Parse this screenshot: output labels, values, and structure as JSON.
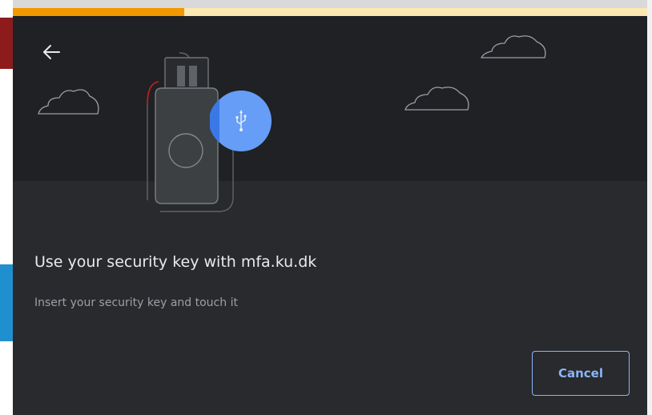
{
  "dialog": {
    "title": "Use your security key with mfa.ku.dk",
    "description": "Insert your security key and touch it",
    "cancel_label": "Cancel",
    "progress_fraction": 0.27,
    "back_icon": "back-arrow-icon",
    "key_icon": "usb-icon"
  },
  "colors": {
    "progress_fill": "#f29900",
    "progress_track": "#fce8b2",
    "accent": "#8ab4f8",
    "usb_badge": "#669df6"
  }
}
